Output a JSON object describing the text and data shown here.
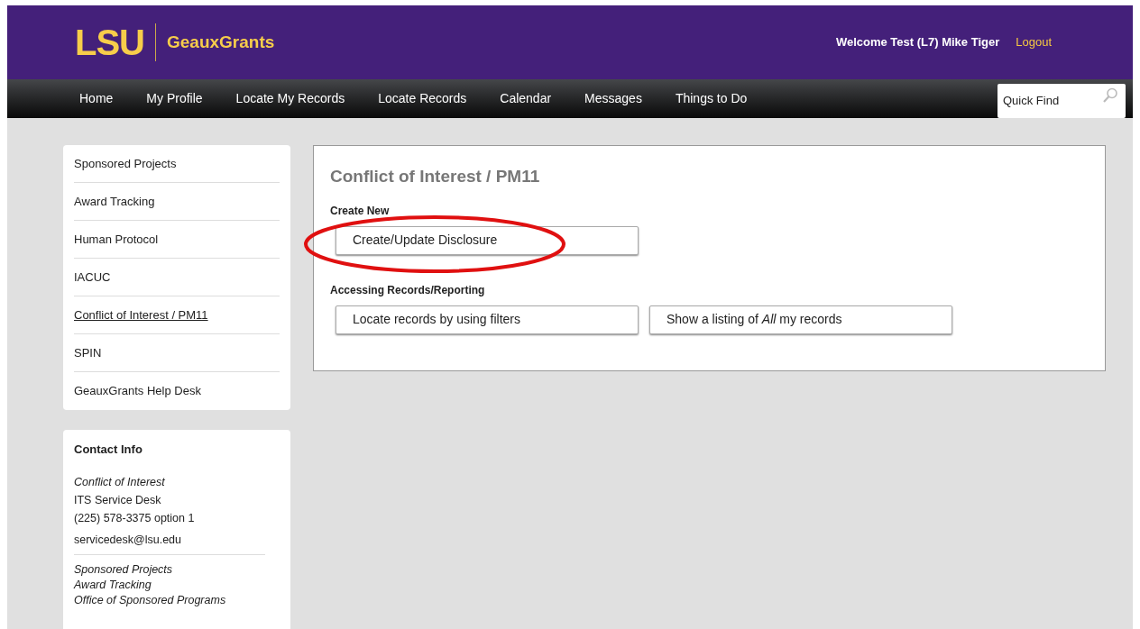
{
  "header": {
    "logo": "LSU",
    "app_name": "GeauxGrants",
    "welcome": "Welcome Test (L7) Mike Tiger",
    "logout": "Logout"
  },
  "nav": {
    "items": [
      "Home",
      "My Profile",
      "Locate My Records",
      "Locate Records",
      "Calendar",
      "Messages",
      "Things to Do"
    ],
    "quick_find": {
      "placeholder": "Quick Find"
    }
  },
  "sidebar": {
    "items": [
      {
        "label": "Sponsored Projects",
        "selected": false
      },
      {
        "label": "Award Tracking",
        "selected": false
      },
      {
        "label": "Human Protocol",
        "selected": false
      },
      {
        "label": "IACUC",
        "selected": false
      },
      {
        "label": "Conflict of Interest / PM11",
        "selected": true
      },
      {
        "label": "SPIN",
        "selected": false
      },
      {
        "label": "GeauxGrants Help Desk",
        "selected": false
      }
    ]
  },
  "contact": {
    "title": "Contact Info",
    "groups": [
      {
        "lines": [
          {
            "text": "Conflict of Interest",
            "italic": true
          },
          {
            "text": "ITS Service Desk",
            "italic": false
          },
          {
            "text": "(225) 578-3375 option 1",
            "italic": false
          },
          {
            "text": "servicedesk@lsu.edu",
            "italic": false
          }
        ]
      },
      {
        "lines": [
          {
            "text": "Sponsored Projects",
            "italic": true
          },
          {
            "text": "Award Tracking",
            "italic": true
          },
          {
            "text": "Office of Sponsored Programs",
            "italic": true
          }
        ]
      }
    ]
  },
  "main": {
    "title": "Conflict of Interest / PM11",
    "sections": [
      {
        "heading": "Create New",
        "buttons": [
          {
            "label": "Create/Update Disclosure",
            "circled": true
          }
        ]
      },
      {
        "heading": "Accessing Records/Reporting",
        "buttons": [
          {
            "label": "Locate records by using filters",
            "circled": false
          },
          {
            "label": "Show a listing of *All* my records",
            "circled": false
          }
        ]
      }
    ]
  }
}
